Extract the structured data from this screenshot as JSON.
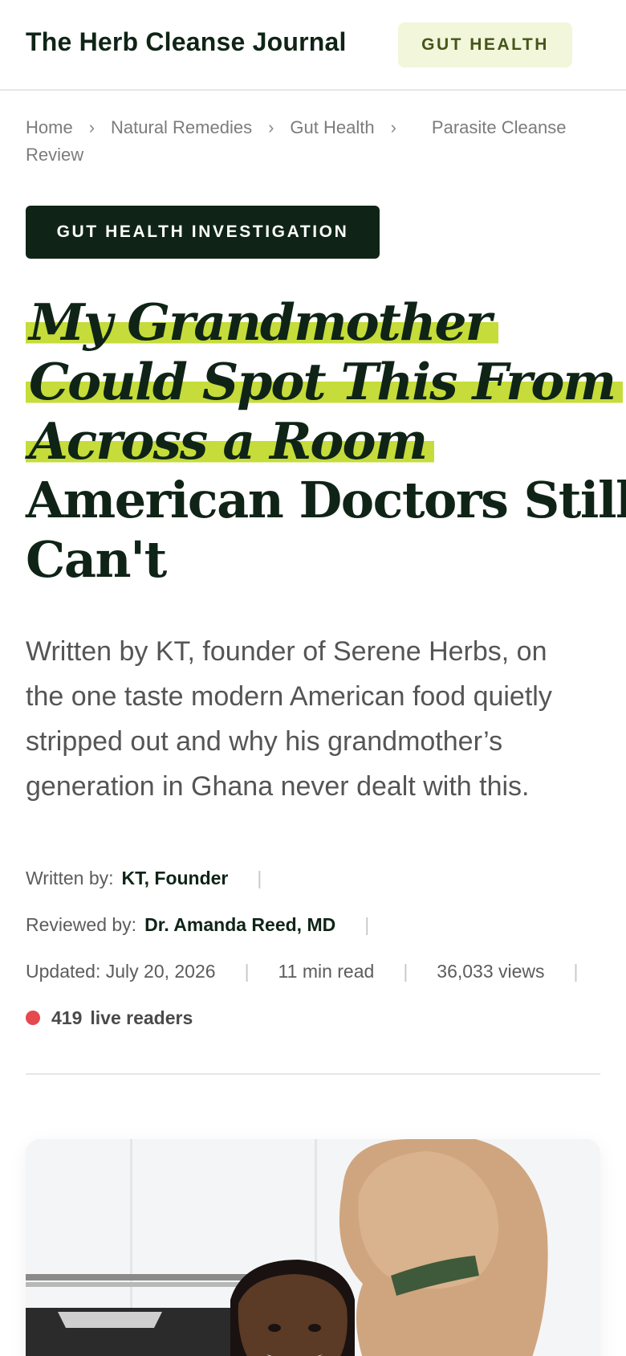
{
  "header": {
    "site_title": "The Herb Cleanse Journal",
    "category": "GUT HEALTH"
  },
  "breadcrumb": {
    "items": [
      "Home",
      "Natural Remedies",
      "Gut Health",
      "Parasite Cleanse Review"
    ],
    "separator": "›"
  },
  "article": {
    "kicker": "GUT HEALTH INVESTIGATION",
    "headline_highlight_lines": [
      "My Grandmother",
      "Could Spot This From",
      "Across a Room"
    ],
    "headline_plain_lines": [
      "American Doctors Still",
      "Can't"
    ],
    "dek": "Written by KT, founder of Serene Herbs, on the one taste modern American food quietly stripped out and why his grandmother’s generation in Ghana never dealt with this.",
    "meta": {
      "written_by_label": "Written by:",
      "written_by": "KT, Founder",
      "reviewed_by_label": "Reviewed by:",
      "reviewed_by": "Dr. Amanda Reed, MD",
      "updated": "Updated: July 20, 2026",
      "read_time": "11 min read",
      "views": "36,033 views",
      "live_count": "419",
      "live_label": "live readers"
    }
  },
  "colors": {
    "brand_dark": "#0f2416",
    "highlight": "#c5dc3a",
    "pill_bg": "#f2f6da",
    "live_dot": "#e5484d"
  },
  "hero_image": {
    "icon": "photo-man-with-dog"
  }
}
